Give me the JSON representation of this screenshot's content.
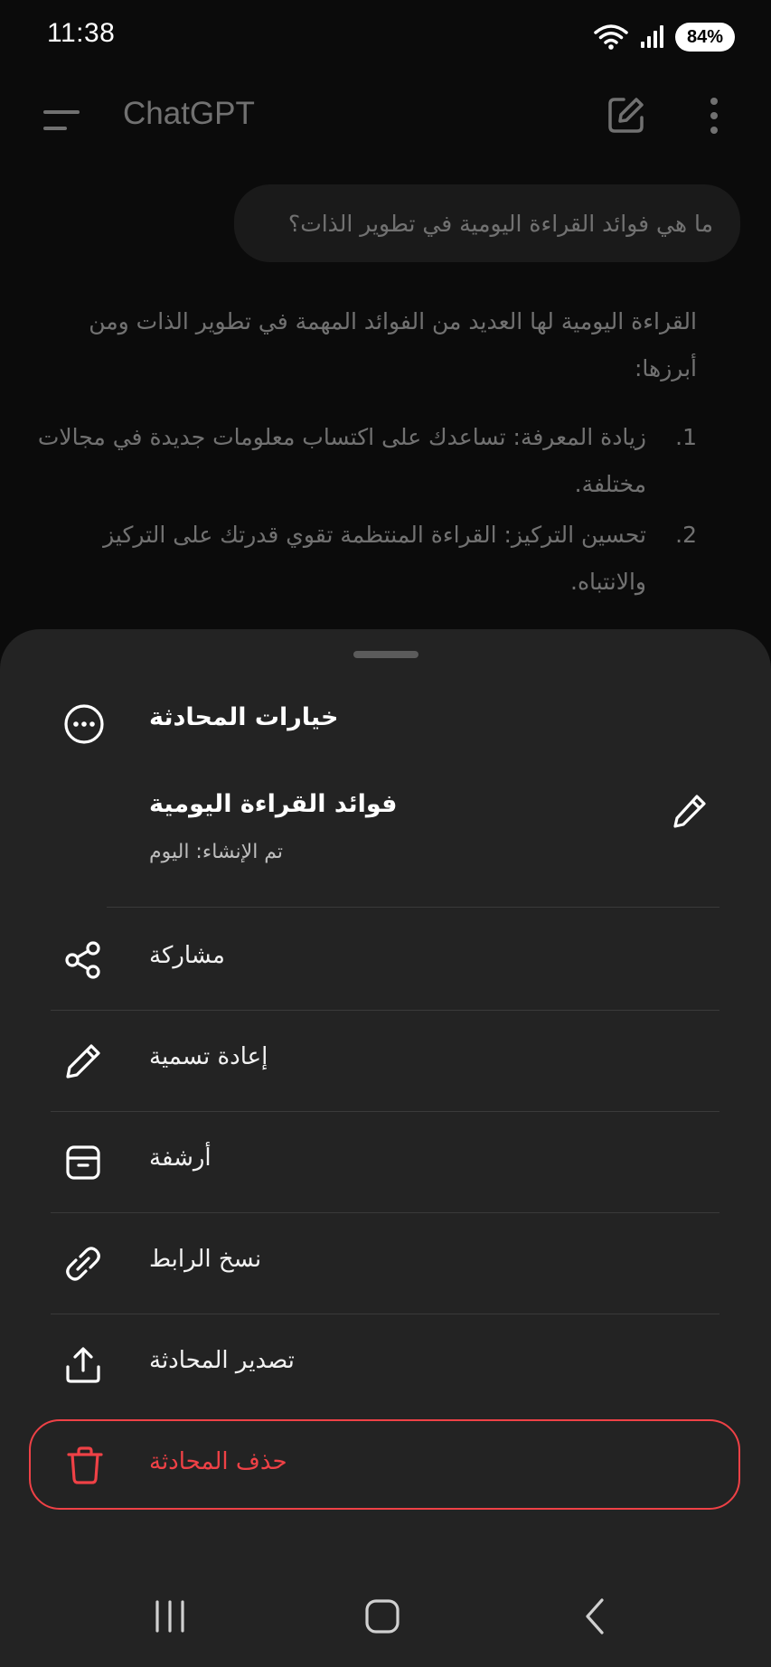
{
  "status_bar": {
    "time": "11:38",
    "battery": "84%",
    "icons": [
      "wifi-icon",
      "signal-icon",
      "battery-icon"
    ]
  },
  "top_bar": {
    "title": "ChatGPT",
    "icons": [
      "sidebar-menu-icon",
      "new-chat-icon",
      "more-vertical-icon"
    ]
  },
  "conversation": {
    "user_message": "ما هي فوائد القراءة اليومية في تطوير الذات؟",
    "assistant_intro": "القراءة اليومية لها العديد من الفوائد المهمة في تطوير الذات ومن أبرزها:",
    "assistant_items": [
      {
        "number": "1.",
        "text": "زيادة المعرفة: تساعدك على اكتساب معلومات جديدة في مجالات مختلفة."
      },
      {
        "number": "2.",
        "text": "تحسين التركيز: القراءة المنتظمة تقوي قدرتك على التركيز والانتباه."
      }
    ]
  },
  "sheet": {
    "header_title": "خيارات المحادثة",
    "conversation_title": "فوائد القراءة اليومية",
    "created_label": "تم الإنشاء: اليوم",
    "items": [
      {
        "label": "مشاركة",
        "icon": "share-icon"
      },
      {
        "label": "إعادة تسمية",
        "icon": "pencil-icon"
      },
      {
        "label": "أرشفة",
        "icon": "archive-icon"
      },
      {
        "label": "نسخ الرابط",
        "icon": "link-icon"
      },
      {
        "label": "تصدير المحادثة",
        "icon": "export-icon"
      }
    ],
    "delete_label": "حذف المحادثة",
    "delete_color": "#ef4146"
  },
  "nav_bar": {
    "icons": [
      "recent-apps-icon",
      "home-icon",
      "back-icon"
    ]
  }
}
